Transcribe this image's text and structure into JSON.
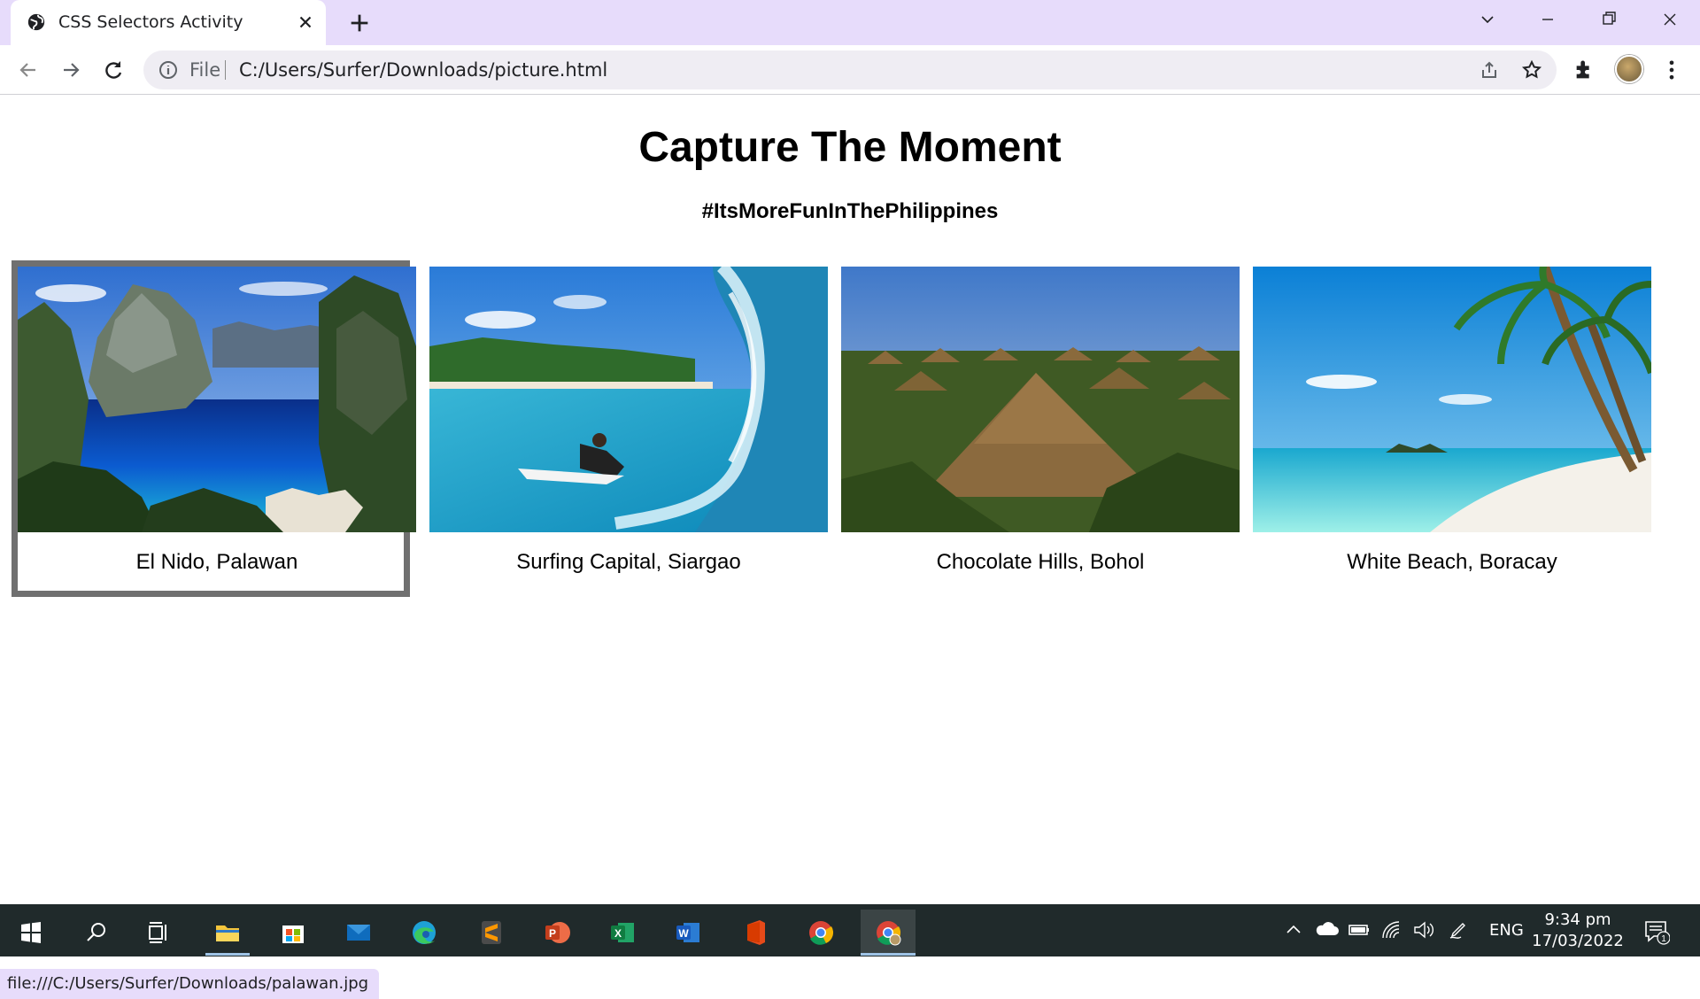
{
  "browser": {
    "tab_title": "CSS Selectors Activity",
    "address_scheme": "File",
    "address_url": "C:/Users/Surfer/Downloads/picture.html",
    "status_url": "file:///C:/Users/Surfer/Downloads/palawan.jpg"
  },
  "page": {
    "heading": "Capture The Moment",
    "hashtag": "#ItsMoreFunInThePhilippines",
    "gallery": [
      {
        "caption": "El Nido, Palawan",
        "selected": true
      },
      {
        "caption": "Surfing Capital, Siargao",
        "selected": false
      },
      {
        "caption": "Chocolate Hills, Bohol",
        "selected": false
      },
      {
        "caption": "White Beach, Boracay",
        "selected": false
      }
    ]
  },
  "taskbar": {
    "apps": [
      "start",
      "search",
      "task-view",
      "file-explorer",
      "microsoft-store",
      "mail",
      "edge",
      "sublime-text",
      "powerpoint",
      "excel",
      "word",
      "office",
      "chrome",
      "chrome-profile"
    ],
    "language": "ENG",
    "time": "9:34 pm",
    "date": "17/03/2022",
    "notification_count": "1"
  },
  "colors": {
    "chrome_frame": "#e7dcfb",
    "selected_border": "#707070",
    "taskbar": "#202a2b"
  }
}
